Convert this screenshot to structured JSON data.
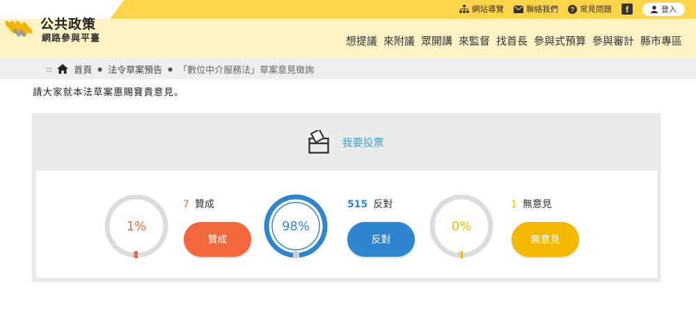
{
  "site": {
    "title": "公共政策",
    "subtitle": "網路參與平臺"
  },
  "toplinks": {
    "sitemap": "網站導覽",
    "contact": "聯絡我們",
    "faq": "常見問題",
    "login": "登入"
  },
  "nav": [
    "想提議",
    "來附議",
    "眾開講",
    "來監督",
    "找首長",
    "參與式預算",
    "參與審計",
    "縣市專區"
  ],
  "breadcrumb": {
    "home": "首頁",
    "section": "法令草案預告",
    "current": "「數位中介服務法」草案意見徵詢"
  },
  "intro": "請大家就本法草案惠賜寶貴意見。",
  "vote": {
    "title": "我要投票",
    "agree": {
      "count": "7",
      "label": "贊成",
      "percent_text": "1%",
      "fraction": 0.01,
      "button": "贊成",
      "color": "#f2683c"
    },
    "oppose": {
      "count": "515",
      "label": "反對",
      "percent_text": "98%",
      "fraction": 0.98,
      "button": "反對",
      "color": "#2e86d1"
    },
    "neutral": {
      "count": "1",
      "label": "無意見",
      "percent_text": "0%",
      "fraction": 0.0,
      "button": "無意見",
      "color": "#f5b800"
    }
  },
  "colors": {
    "header_bg": "#fdf3c4",
    "accent_yellow": "#ffd54a",
    "vote_title": "#4aa0c7"
  }
}
